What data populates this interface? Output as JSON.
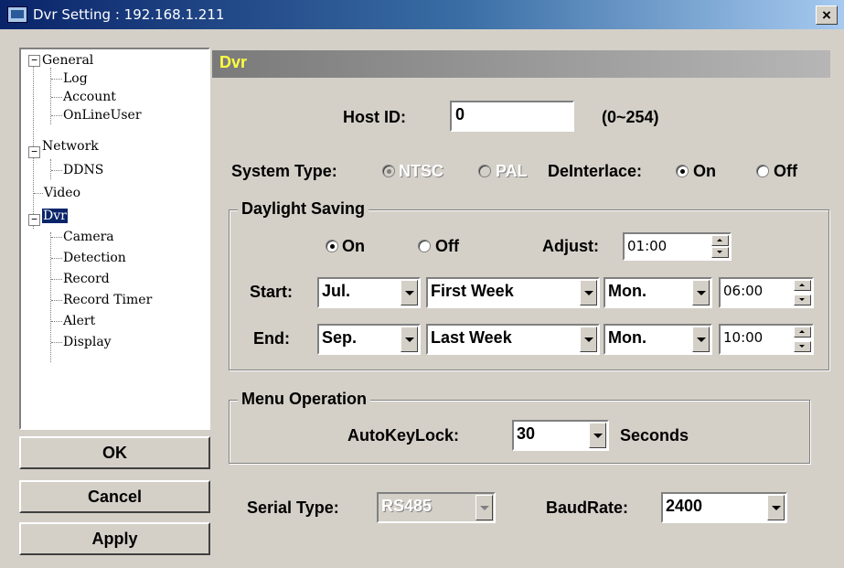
{
  "window": {
    "title": "Dvr Setting : 192.168.1.211",
    "close_label": "×"
  },
  "tree": {
    "items": [
      {
        "label": "General",
        "expander": "−"
      },
      {
        "label": "Log"
      },
      {
        "label": "Account"
      },
      {
        "label": "OnLineUser"
      },
      {
        "label": "Network",
        "expander": "−"
      },
      {
        "label": "DDNS"
      },
      {
        "label": "Video"
      },
      {
        "label": "Dvr",
        "expander": "−"
      },
      {
        "label": "Camera"
      },
      {
        "label": "Detection"
      },
      {
        "label": "Record"
      },
      {
        "label": "Record Timer"
      },
      {
        "label": "Alert"
      },
      {
        "label": "Display"
      }
    ]
  },
  "buttons": {
    "ok": "OK",
    "cancel": "Cancel",
    "apply": "Apply"
  },
  "section": {
    "title": "Dvr"
  },
  "host": {
    "label": "Host ID:",
    "value": "0",
    "range": "(0~254)"
  },
  "system": {
    "label": "System Type:",
    "ntsc": "NTSC",
    "pal": "PAL",
    "deinterlace_label": "DeInterlace:",
    "on": "On",
    "off": "Off",
    "selected_system": "NTSC",
    "deinterlace": "On"
  },
  "daylight": {
    "title": "Daylight Saving",
    "on": "On",
    "off": "Off",
    "selected": "On",
    "adjust_label": "Adjust:",
    "adjust_value": "01:00",
    "start_label": "Start:",
    "start_month": "Jul.",
    "start_week": "First Week",
    "start_day": "Mon.",
    "start_time": "06:00",
    "end_label": "End:",
    "end_month": "Sep.",
    "end_week": "Last Week",
    "end_day": "Mon.",
    "end_time": "10:00"
  },
  "menu": {
    "title": "Menu Operation",
    "autokeylock_label": "AutoKeyLock:",
    "autokeylock_value": "30",
    "seconds": "Seconds"
  },
  "serial": {
    "label": "Serial Type:",
    "value": "RS485",
    "baud_label": "BaudRate:",
    "baud_value": "2400"
  }
}
